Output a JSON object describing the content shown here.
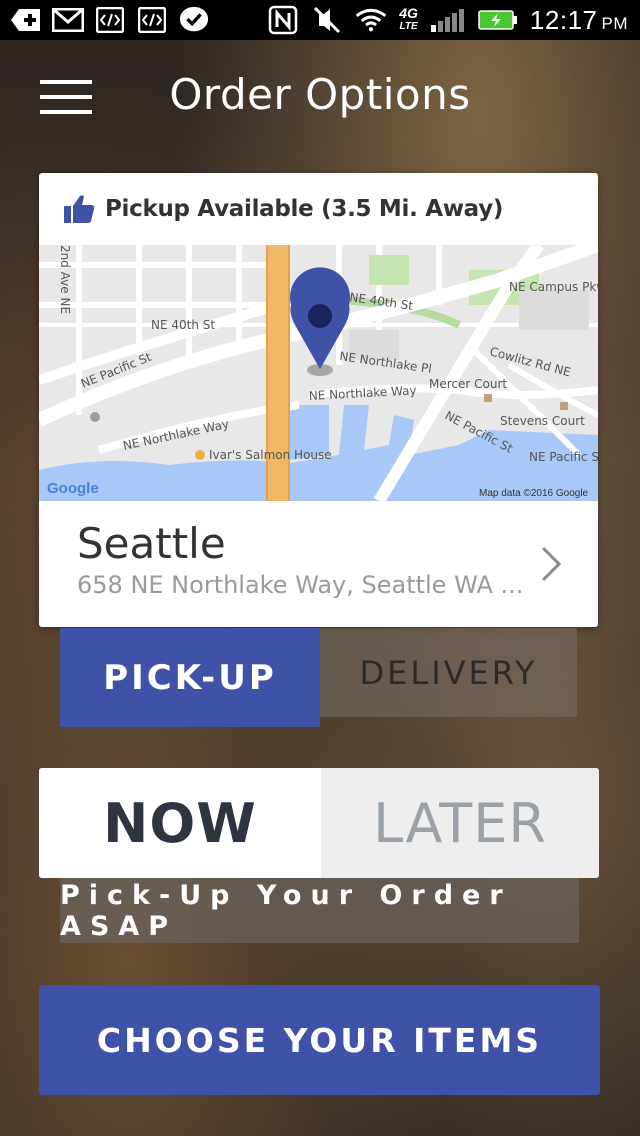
{
  "status_bar": {
    "icons": [
      "add-icon",
      "gmail-icon",
      "code-icon",
      "code-icon",
      "check-bubble-icon",
      "nfc-icon",
      "mute-icon",
      "wifi-icon",
      "signal-icon",
      "battery-charging-icon"
    ],
    "network": "4G",
    "network_sub": "LTE",
    "time": "12:17",
    "ampm": "PM"
  },
  "header": {
    "title": "Order Options",
    "menu_icon": "hamburger-menu-icon"
  },
  "location_card": {
    "availability": "Pickup Available (3.5 Mi. Away)",
    "availability_icon": "thumbs-up-icon",
    "map": {
      "labels": [
        "2nd Ave NE",
        "NE 40th St",
        "NE 40th St",
        "NE Campus Pkwy",
        "NE Northlake Pl",
        "Cowlitz Rd NE",
        "NE Pacific St",
        "Mercer Court",
        "NE Northlake Way",
        "Stevens Court",
        "NE Pacific St",
        "NE Northlake Way",
        "NE Pacific S",
        "Ivar's Salmon House"
      ],
      "logo": "Google",
      "attribution": "Map data ©2016 Google"
    },
    "store_name": "Seattle",
    "store_address": "658 NE Northlake Way, Seattle WA ..."
  },
  "order_mode": {
    "pickup_label": "PICK-UP",
    "delivery_label": "DELIVERY",
    "selected": "PICK-UP"
  },
  "order_time": {
    "now_label": "NOW",
    "later_label": "LATER",
    "selected": "NOW",
    "hint": "Pick-Up Your Order ASAP"
  },
  "cta": {
    "label": "CHOOSE YOUR ITEMS"
  },
  "colors": {
    "accent": "#3f52a8",
    "status_bar": "#000000",
    "map_water": "#a8c8f8",
    "map_highway": "#f2b765",
    "map_park": "#c4e4b0"
  }
}
